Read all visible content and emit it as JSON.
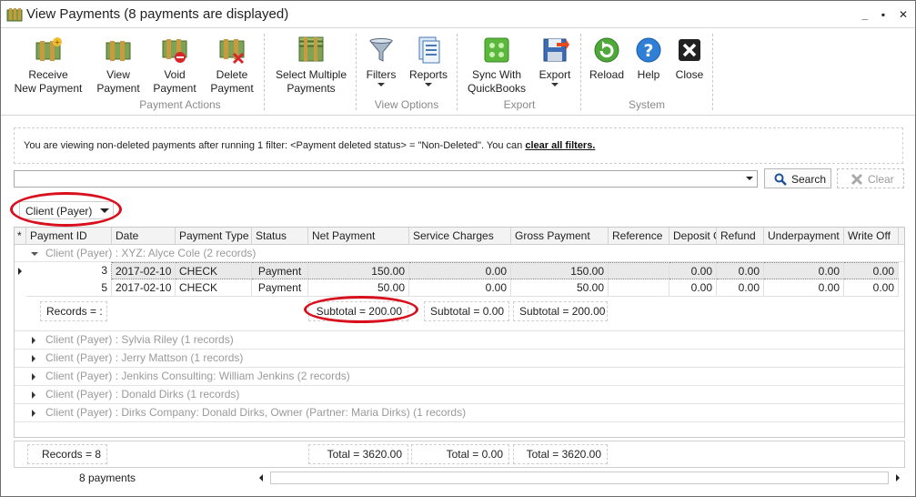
{
  "window": {
    "title": "View Payments (8 payments are displayed)",
    "minimize": "_",
    "maximize": "▪",
    "close": "✕"
  },
  "ribbon": {
    "groups": {
      "payment_actions": "Payment Actions",
      "view_options": "View Options",
      "export": "Export",
      "system": "System"
    },
    "buttons": {
      "receive": [
        "Receive",
        "New Payment"
      ],
      "view": [
        "View",
        "Payment"
      ],
      "void": [
        "Void",
        "Payment"
      ],
      "delete": [
        "Delete",
        "Payment"
      ],
      "select_multiple": [
        "Select Multiple",
        "Payments"
      ],
      "filters": [
        "Filters"
      ],
      "reports": [
        "Reports"
      ],
      "sync": [
        "Sync With",
        "QuickBooks"
      ],
      "export": [
        "Export"
      ],
      "reload": [
        "Reload"
      ],
      "help": [
        "Help"
      ],
      "close": [
        "Close"
      ]
    }
  },
  "filter_info": {
    "text": "You are viewing non-deleted payments after running 1 filter: <Payment deleted status> = \"Non-Deleted\".  You can ",
    "link": "clear all filters."
  },
  "search": {
    "value": "",
    "search_label": "Search",
    "clear_label": "Clear"
  },
  "group_by": {
    "selected": "Client (Payer)"
  },
  "grid": {
    "columns": [
      "Payment ID",
      "Date",
      "Payment Type",
      "Status",
      "Net Payment",
      "Service Charges",
      "Gross Payment",
      "Reference",
      "Deposit G",
      "Refund",
      "Underpayment",
      "Write Off"
    ],
    "expanded_group": "Client (Payer) : XYZ: Alyce Cole (2 records)",
    "rows": [
      {
        "id": "3",
        "date": "2017-02-10",
        "type": "CHECK",
        "status": "Payment",
        "net": "150.00",
        "service": "0.00",
        "gross": "150.00",
        "reference": "",
        "deposit": "0.00",
        "refund": "0.00",
        "underpayment": "0.00",
        "writeoff": "0.00"
      },
      {
        "id": "5",
        "date": "2017-02-10",
        "type": "CHECK",
        "status": "Payment",
        "net": "50.00",
        "service": "0.00",
        "gross": "50.00",
        "reference": "",
        "deposit": "0.00",
        "refund": "0.00",
        "underpayment": "0.00",
        "writeoff": "0.00"
      }
    ],
    "group_summary": {
      "records": "Records = :",
      "net": "Subtotal = 200.00",
      "service": "Subtotal = 0.00",
      "gross": "Subtotal = 200.00"
    },
    "collapsed_groups": [
      "Client (Payer) : Sylvia Riley (1 records)",
      "Client (Payer) : Jerry Mattson (1 records)",
      "Client (Payer) : Jenkins Consulting: William Jenkins (2 records)",
      "Client (Payer) : Donald Dirks (1 records)",
      "Client (Payer) : Dirks Company: Donald Dirks, Owner (Partner: Maria Dirks) (1 records)"
    ]
  },
  "footer": {
    "records": "Records = 8",
    "net_total": "Total = 3620.00",
    "service_total": "Total = 0.00",
    "gross_total": "Total = 3620.00"
  },
  "status": {
    "count": "8 payments"
  },
  "colors": {
    "annotation": "#d80f1c",
    "selection": "#e9e9e9"
  }
}
